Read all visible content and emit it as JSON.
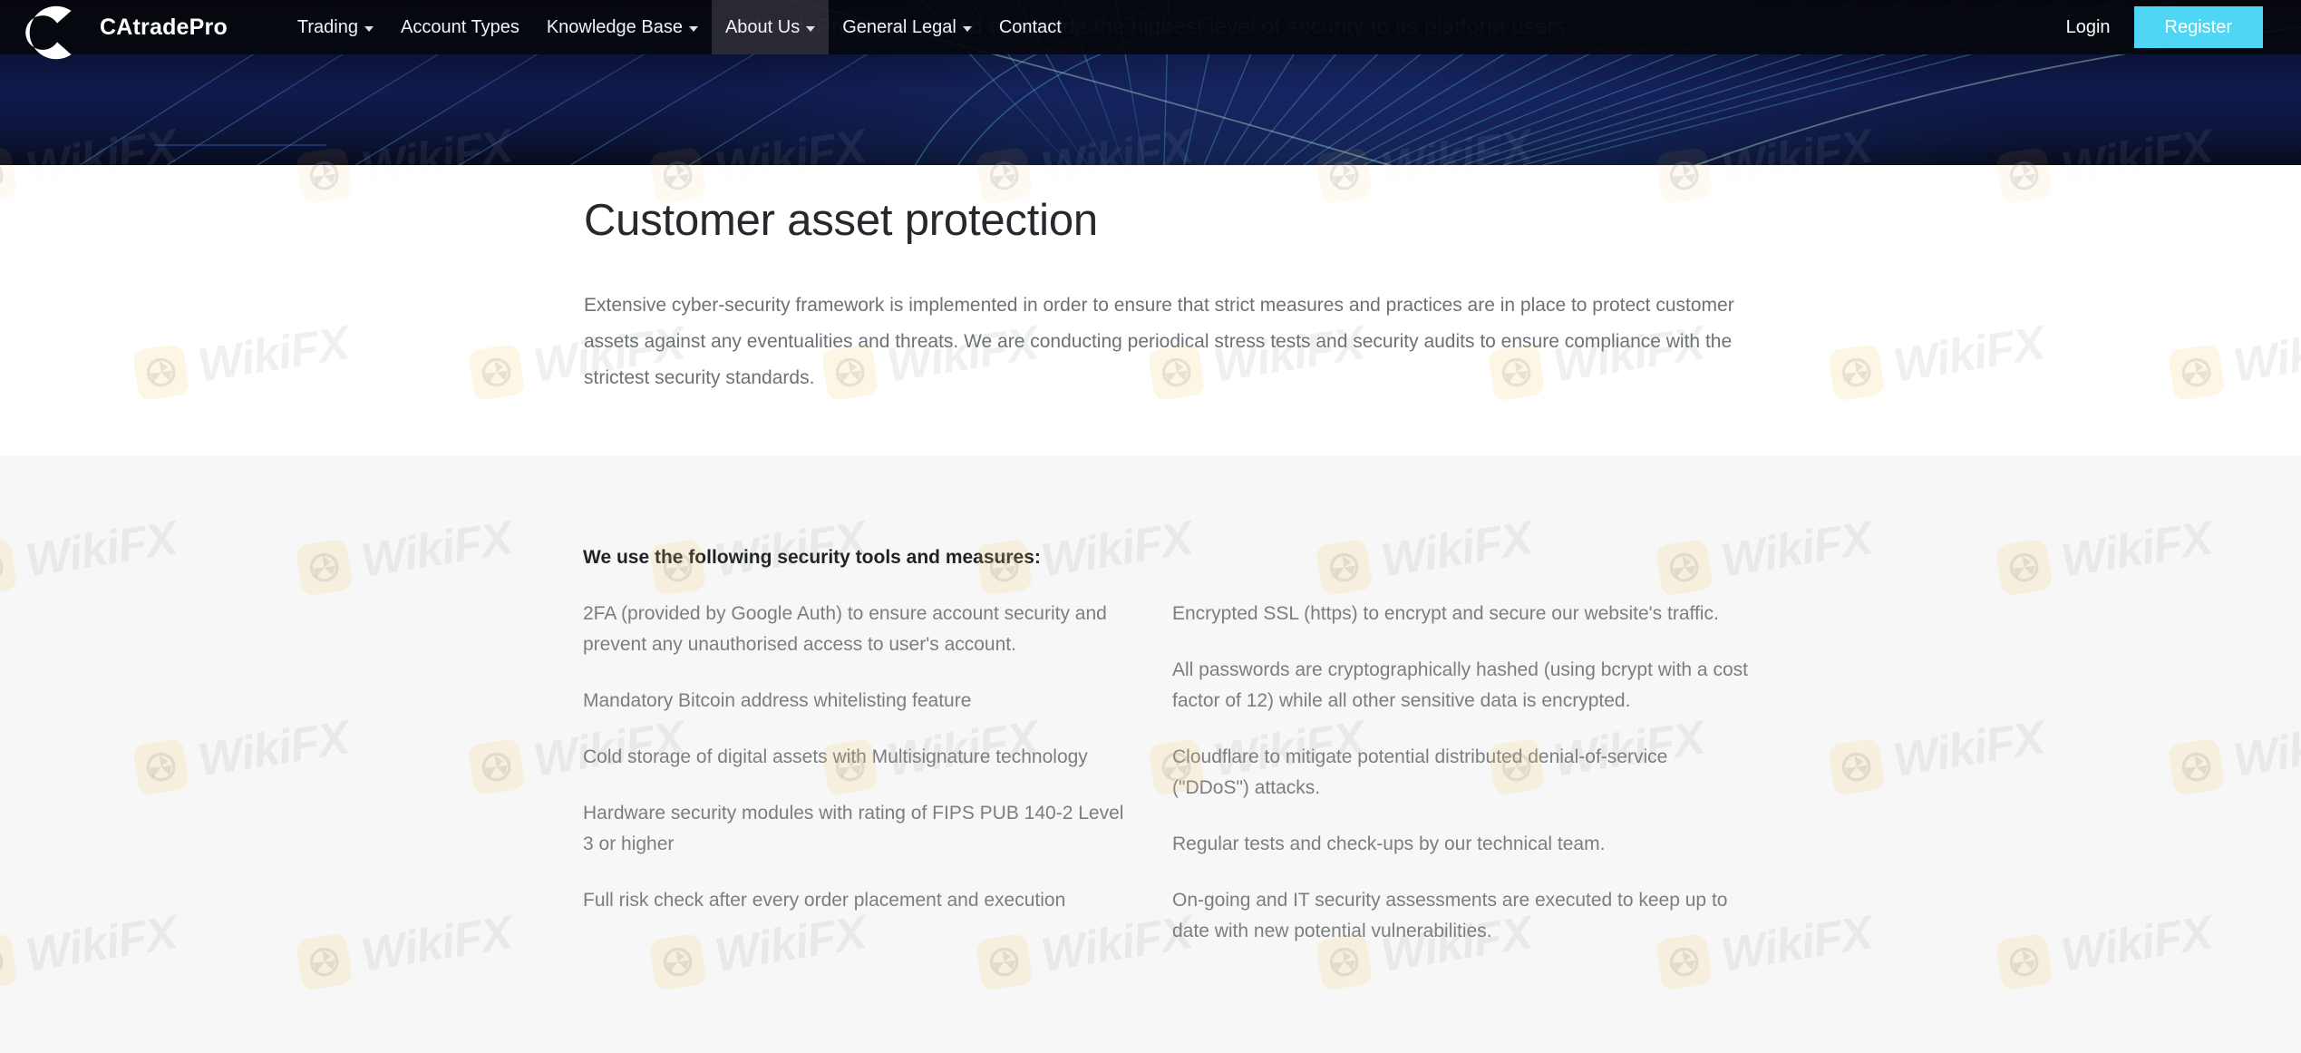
{
  "brand": {
    "name": "CAtradePro",
    "logo_icon": "letter-c-logo"
  },
  "nav": {
    "items": [
      {
        "label": "Trading",
        "has_dropdown": true,
        "active": false
      },
      {
        "label": "Account Types",
        "has_dropdown": false,
        "active": false
      },
      {
        "label": "Knowledge Base",
        "has_dropdown": true,
        "active": false
      },
      {
        "label": "About Us",
        "has_dropdown": true,
        "active": true
      },
      {
        "label": "General Legal",
        "has_dropdown": true,
        "active": false
      },
      {
        "label": "Contact",
        "has_dropdown": false,
        "active": false
      }
    ],
    "login_label": "Login",
    "register_label": "Register",
    "register_color": "#4fd6f5"
  },
  "hero": {
    "tagline": "CAtradePro is committed to provide the highest level of security to its platform users",
    "background_color": "#0a1030"
  },
  "intro": {
    "title": "Customer asset protection",
    "paragraph": "Extensive cyber-security framework is implemented in order to ensure that strict measures and practices are in place to protect customer assets against any eventualities and threats. We are conducting periodical stress tests and security audits to ensure compliance with the strictest security standards."
  },
  "tools": {
    "heading": "We use the following security tools and measures:",
    "left_column": [
      "2FA (provided by Google Auth) to ensure account security and prevent any unauthorised access to user's account.",
      "Mandatory Bitcoin address whitelisting feature",
      "Cold storage of digital assets with Multisignature technology",
      "Hardware security modules with rating of FIPS PUB 140-2 Level 3 or higher",
      "Full risk check after every order placement and execution"
    ],
    "right_column": [
      "Encrypted SSL (https) to encrypt and secure our website's traffic.",
      "All passwords are cryptographically hashed (using bcrypt with a cost factor of 12) while all other sensitive data is encrypted.",
      "Cloudflare to mitigate potential distributed denial-of-service (\"DDoS\") attacks.",
      "Regular tests and check-ups by our technical team.",
      "On-going and IT security assessments are executed to keep up to date with new potential vulnerabilities."
    ]
  },
  "watermark": {
    "text": "WikiFX",
    "icon": "wikifx-aperture-icon"
  },
  "colors": {
    "page_background": "#ffffff",
    "section_background": "#f7f7f7",
    "nav_background": "#06070e",
    "accent": "#4fd6f5",
    "body_text": "#6d7175",
    "heading_text": "#25282c"
  }
}
